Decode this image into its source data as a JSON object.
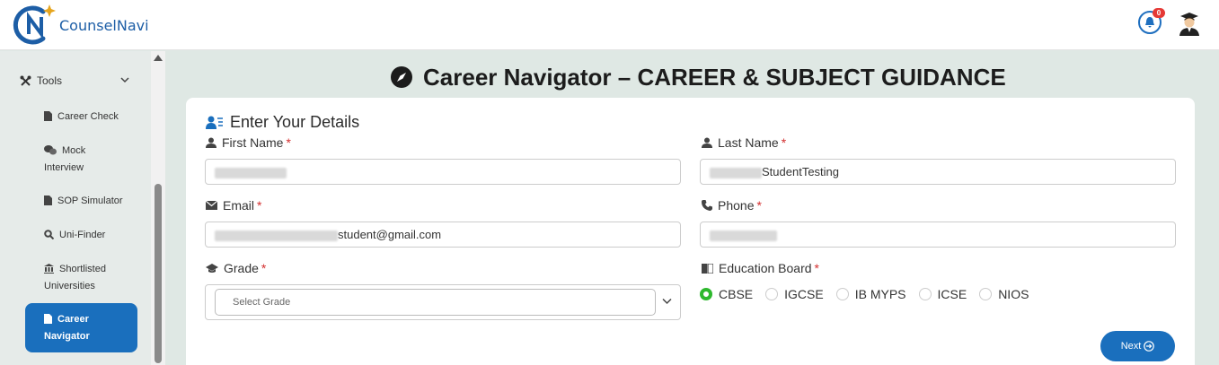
{
  "app": {
    "brand": "CounselNavi",
    "notification_count": "0"
  },
  "sidebar": {
    "group_label": "Tools",
    "items": [
      {
        "label": "Career Check"
      },
      {
        "label_line1": "Mock",
        "label_line2": "Interview"
      },
      {
        "label": "SOP Simulator"
      },
      {
        "label": "Uni-Finder"
      },
      {
        "label_line1": "Shortlisted",
        "label_line2": "Universities"
      },
      {
        "label_line1": "Career",
        "label_line2": "Navigator",
        "active": true
      }
    ]
  },
  "page": {
    "title": "Career Navigator – CAREER & SUBJECT GUIDANCE",
    "section_title": "Enter Your Details"
  },
  "form": {
    "first_name": {
      "label": "First Name",
      "value": ""
    },
    "last_name": {
      "label": "Last Name",
      "value": "StudentTesting"
    },
    "email": {
      "label": "Email",
      "value": "student@gmail.com"
    },
    "phone": {
      "label": "Phone",
      "value": ""
    },
    "grade": {
      "label": "Grade",
      "placeholder": "Select Grade"
    },
    "board": {
      "label": "Education Board",
      "options": [
        "CBSE",
        "IGCSE",
        "IB MYPS",
        "ICSE",
        "NIOS"
      ],
      "selected": "CBSE"
    },
    "required_mark": "*",
    "next_label": "Next"
  },
  "colors": {
    "primary": "#1a6fbd",
    "radio_selected": "#2eb82e",
    "required": "#d32f2f"
  }
}
